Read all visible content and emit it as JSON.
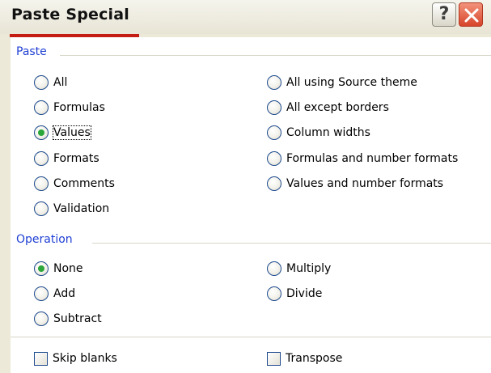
{
  "window": {
    "title": "Paste Special",
    "help_glyph": "?"
  },
  "paste": {
    "label": "Paste",
    "options": [
      {
        "label": "All",
        "checked": false
      },
      {
        "label": "Formulas",
        "checked": false
      },
      {
        "label": "Values",
        "checked": true
      },
      {
        "label": "Formats",
        "checked": false
      },
      {
        "label": "Comments",
        "checked": false
      },
      {
        "label": "Validation",
        "checked": false
      },
      {
        "label": "All using Source theme",
        "checked": false
      },
      {
        "label": "All except borders",
        "checked": false
      },
      {
        "label": "Column widths",
        "checked": false
      },
      {
        "label": "Formulas and number formats",
        "checked": false
      },
      {
        "label": "Values and number formats",
        "checked": false
      }
    ]
  },
  "operation": {
    "label": "Operation",
    "options": [
      {
        "label": "None",
        "checked": true
      },
      {
        "label": "Add",
        "checked": false
      },
      {
        "label": "Subtract",
        "checked": false
      },
      {
        "label": "Multiply",
        "checked": false
      },
      {
        "label": "Divide",
        "checked": false
      }
    ]
  },
  "checkboxes": [
    {
      "label": "Skip blanks",
      "checked": false
    },
    {
      "label": "Transpose",
      "checked": false
    }
  ],
  "colors": {
    "group_label": "#1f3fd4",
    "radio_dot": "#2aa63a",
    "title_accent": "#c41b12",
    "close_button": "#d7452b"
  }
}
